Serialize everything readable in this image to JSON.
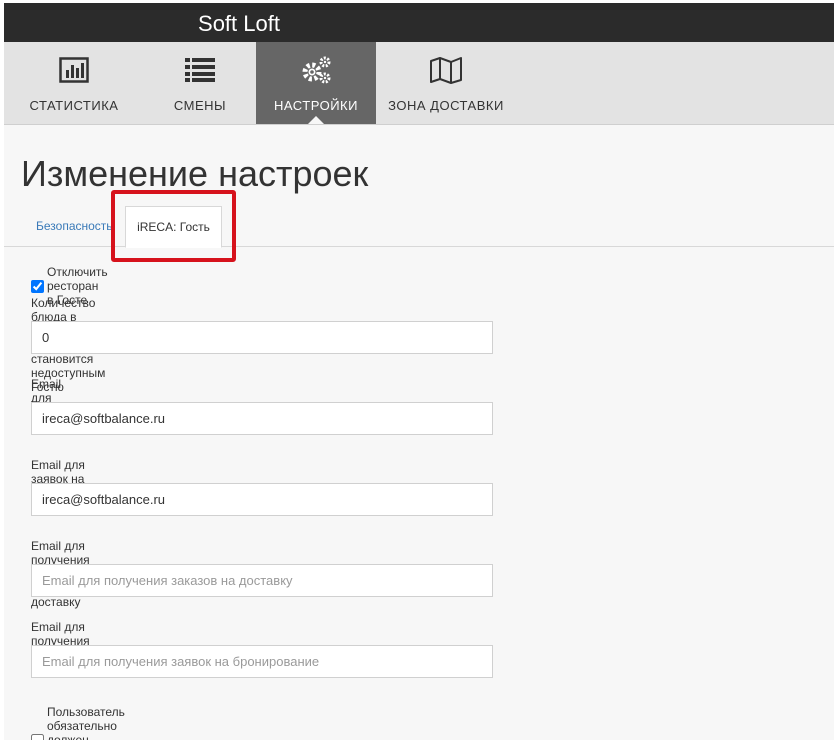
{
  "app": {
    "title": "Soft Loft"
  },
  "nav": {
    "items": [
      {
        "label": "СТАТИСТИКА",
        "icon": "bar-chart-icon"
      },
      {
        "label": "СМЕНЫ",
        "icon": "list-icon"
      },
      {
        "label": "НАСТРОЙКИ",
        "icon": "gears-icon",
        "active": true
      },
      {
        "label": "ЗОНА ДОСТАВКИ",
        "icon": "map-icon"
      }
    ]
  },
  "page": {
    "title": "Изменение настроек"
  },
  "tabs": [
    {
      "label": "Безопасность",
      "active": false
    },
    {
      "label": "iRECA: Гость",
      "active": true
    }
  ],
  "form": {
    "disable_restaurant": {
      "label": "Отключить ресторан в Госте",
      "checked": true
    },
    "stoplist_qty": {
      "label": "Количество блюда в стоп-листе, когда оно становится недоступным Гостю",
      "value": "0"
    },
    "feedback_email": {
      "label": "Email для отправки отзывов",
      "value": "ireca@softbalance.ru"
    },
    "restore_email": {
      "label": "Email для заявок на восстановление доступа",
      "value": "ireca@softbalance.ru"
    },
    "delivery_email": {
      "label": "Email для получения заказов на доставку",
      "value": "",
      "placeholder": "Email для получения заказов на доставку"
    },
    "booking_email": {
      "label": "Email для получения заявок на бронирование",
      "value": "",
      "placeholder": "Email для получения заявок на бронирование"
    },
    "require_profile": {
      "label": "Пользователь обязательно должен заполнять данные в ЛК",
      "checked": false
    }
  },
  "colors": {
    "highlight": "#d6121c",
    "nav_active": "#666666",
    "topbar": "#2b2b2b",
    "link": "#3a7ab8"
  }
}
